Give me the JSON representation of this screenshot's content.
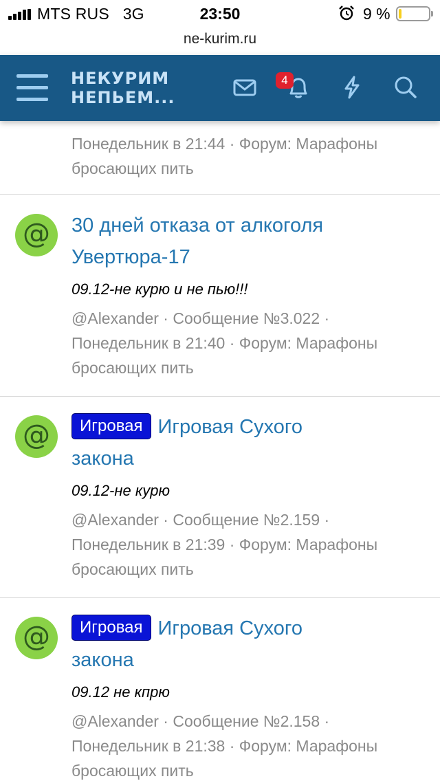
{
  "status_bar": {
    "carrier": "MTS RUS",
    "network": "3G",
    "time": "23:50",
    "battery_percent": "9 %",
    "battery_level": 0.09,
    "battery_color": "#f7cf1e"
  },
  "url": "ne-kurim.ru",
  "header": {
    "logo_line1": "НЕКУРИМ",
    "logo_line2": "НЕПЬЕМ...",
    "notifications_count": "4",
    "icons": [
      "menu-icon",
      "mail-icon",
      "bell-icon",
      "lightning-icon",
      "search-icon"
    ],
    "bg_color": "#185886"
  },
  "previous_item": {
    "meta_line1": "Понедельник в 21:44 · Форум: Марафоны",
    "meta_line2": "бросающих пить"
  },
  "items": [
    {
      "avatar": "@",
      "prefix": "",
      "title_line1": "30 дней отказа от алкоголя",
      "title_line2": "Увертюра-17",
      "snippet": "09.12-не курю и не пью!!!",
      "meta_line1": "@Alexander · Сообщение №3.022 ·",
      "meta_line2": "Понедельник в 21:40 · Форум: Марафоны",
      "meta_line3": "бросающих пить"
    },
    {
      "avatar": "@",
      "prefix": "Игровая",
      "title_line1": "Игровая Сухого",
      "title_line2": "закона",
      "snippet": "09.12-не курю",
      "meta_line1": "@Alexander · Сообщение №2.159 ·",
      "meta_line2": "Понедельник в 21:39 · Форум: Марафоны",
      "meta_line3": "бросающих пить"
    },
    {
      "avatar": "@",
      "prefix": "Игровая",
      "title_line1": "Игровая Сухого",
      "title_line2": "закона",
      "snippet": "09.12 не кпрю",
      "meta_line1": "@Alexander · Сообщение №2.158 ·",
      "meta_line2": "Понедельник в 21:38 · Форум: Марафоны",
      "meta_line3": "бросающих пить"
    }
  ],
  "colors": {
    "link": "#2577b1",
    "prefix_bg": "#0a14d6",
    "avatar_bg": "#8ad247",
    "meta": "#8a8a8a"
  }
}
